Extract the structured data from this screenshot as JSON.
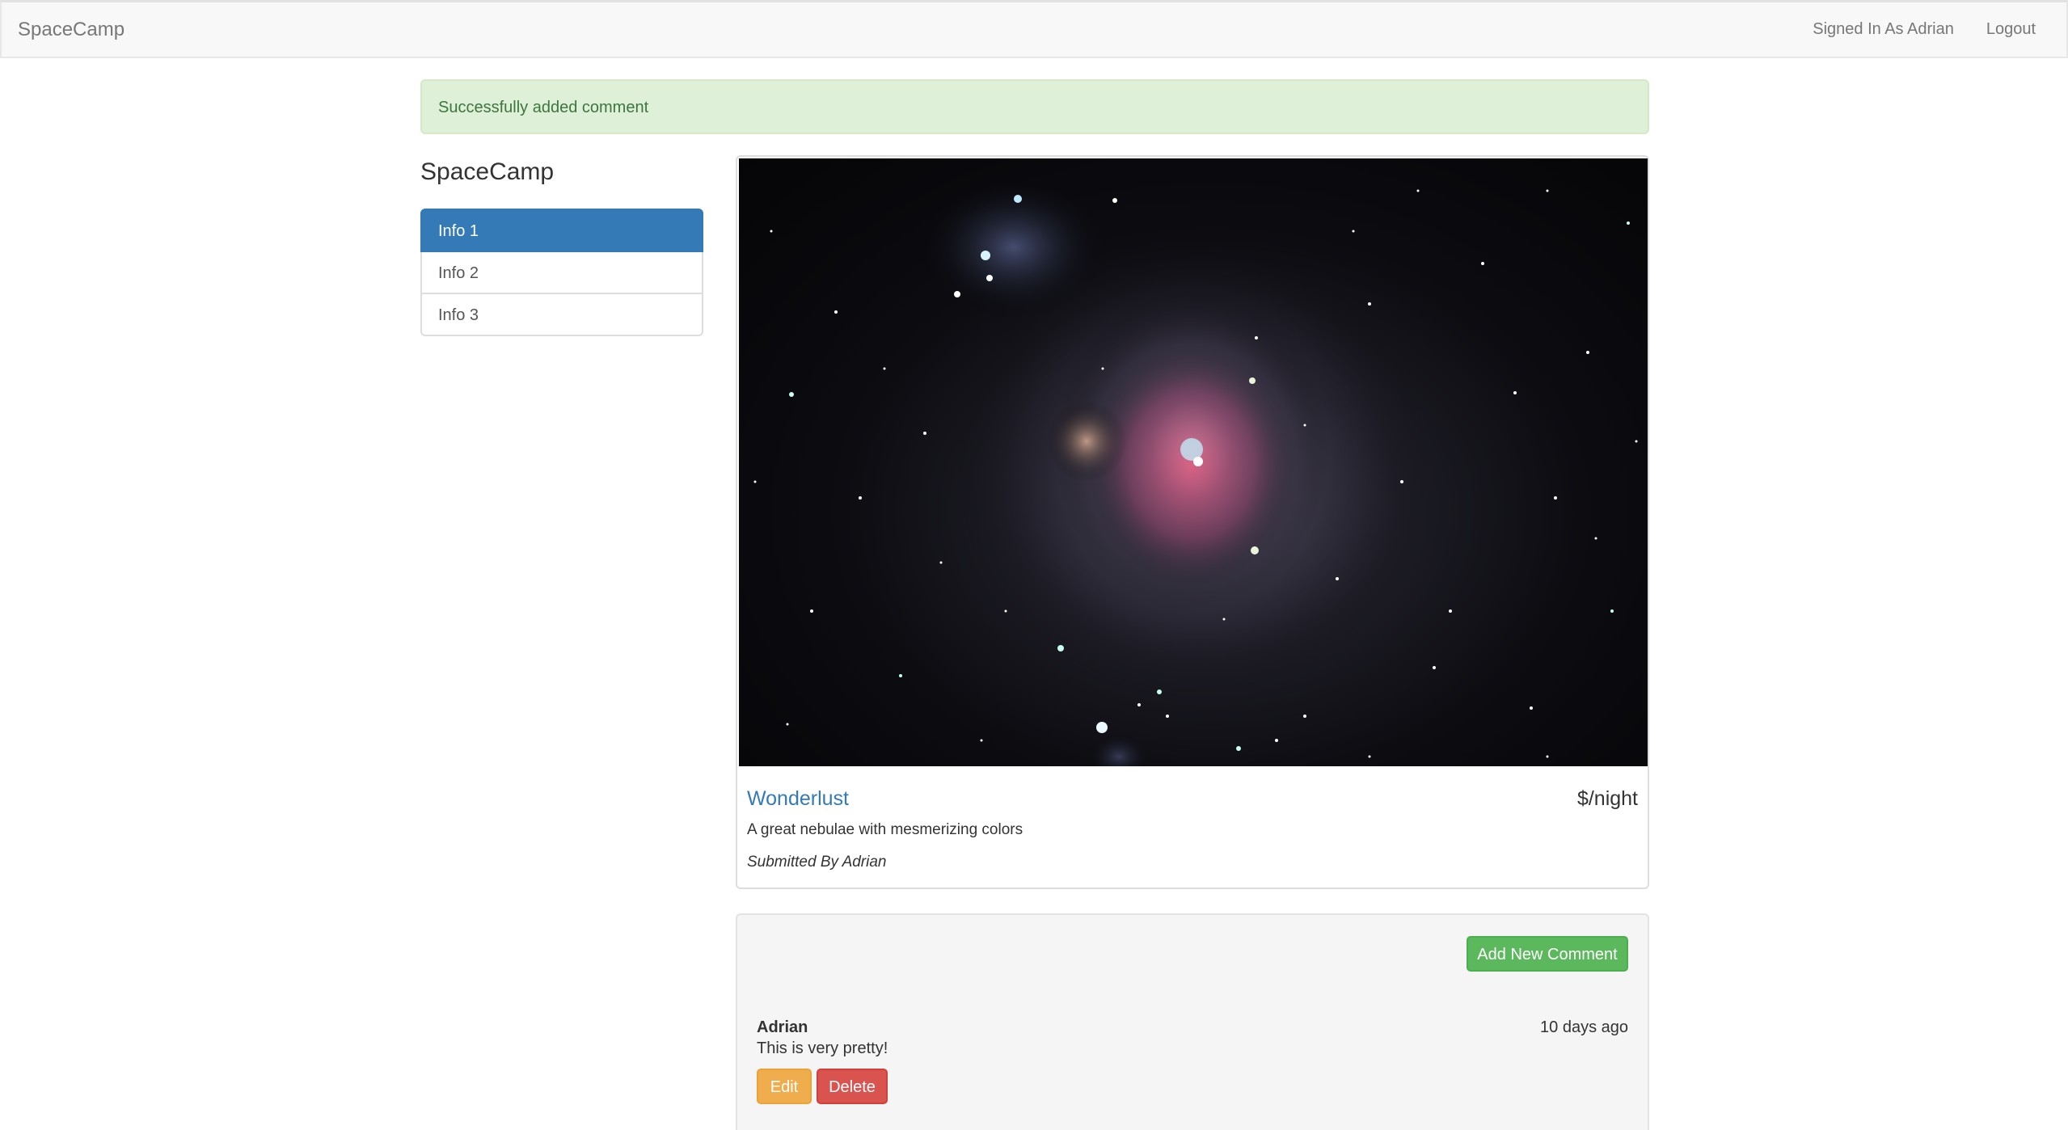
{
  "navbar": {
    "brand": "SpaceCamp",
    "signed_in": "Signed In As Adrian",
    "logout": "Logout"
  },
  "alert": {
    "message": "Successfully added comment"
  },
  "sidebar": {
    "title": "SpaceCamp",
    "items": [
      {
        "label": "Info 1",
        "active": true
      },
      {
        "label": "Info 2",
        "active": false
      },
      {
        "label": "Info 3",
        "active": false
      }
    ]
  },
  "campground": {
    "name": "Wonderlust",
    "price": "$/night",
    "description": "A great nebulae with mesmerizing colors",
    "submitted_by": "Submitted By Adrian"
  },
  "comments": {
    "add_button": "Add New Comment",
    "items": [
      {
        "author": "Adrian",
        "time": "10 days ago",
        "text": "This is very pretty!",
        "edit_label": "Edit",
        "delete_label": "Delete"
      }
    ]
  },
  "colors": {
    "primary": "#337ab7",
    "success": "#5cb85c",
    "warning": "#f0ad4e",
    "danger": "#d9534f",
    "alert_bg": "#dff0d8"
  }
}
